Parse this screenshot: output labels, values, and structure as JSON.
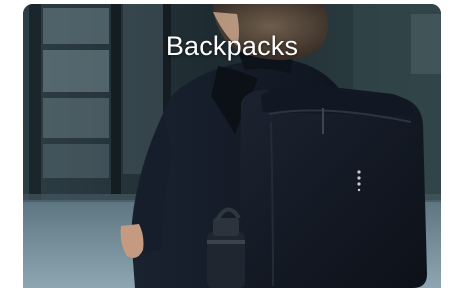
{
  "category_card": {
    "title": "Backpacks",
    "image": "backpack-photo"
  },
  "colors": {
    "title_text": "#ffffff",
    "card_background": "#1b2a33"
  }
}
